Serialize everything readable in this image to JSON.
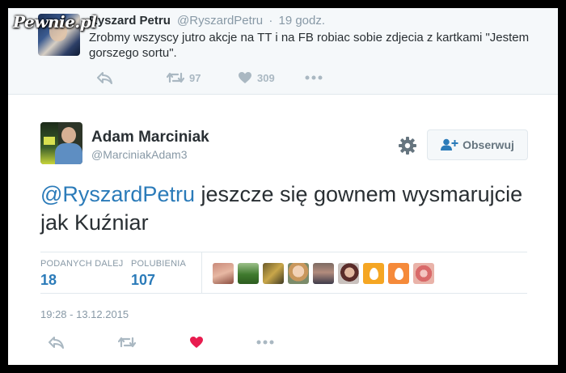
{
  "watermark": "Pewnie.pl",
  "reply_context": {
    "name": "Ryszard Petru",
    "handle": "@RyszardPetru",
    "separator": "·",
    "time": "19 godz.",
    "text": "Zrobmy wszyscy jutro akcje na TT i na FB robiac sobie zdjecia z kartkami \"Jestem gorszego sortu\".",
    "retweets": "97",
    "likes": "309"
  },
  "tweet": {
    "name": "Adam Marciniak",
    "handle": "@MarciniakAdam3",
    "follow_label": "Obserwuj",
    "mention": "@RyszardPetru",
    "text": " jeszcze się gownem wysmarujcie jak Kuźniar",
    "stats": {
      "retweets_label": "PODANYCH DALEJ",
      "retweets": "18",
      "likes_label": "POLUBIENIA",
      "likes": "107"
    },
    "timestamp": "19:28 - 13.12.2015",
    "liked": true
  },
  "colors": {
    "accent": "#2b7bb9",
    "heart": "#e81c4f",
    "icon_gray": "#aab8c2",
    "egg_orange": "#f5a623",
    "egg_orange2": "#f58a3a"
  }
}
